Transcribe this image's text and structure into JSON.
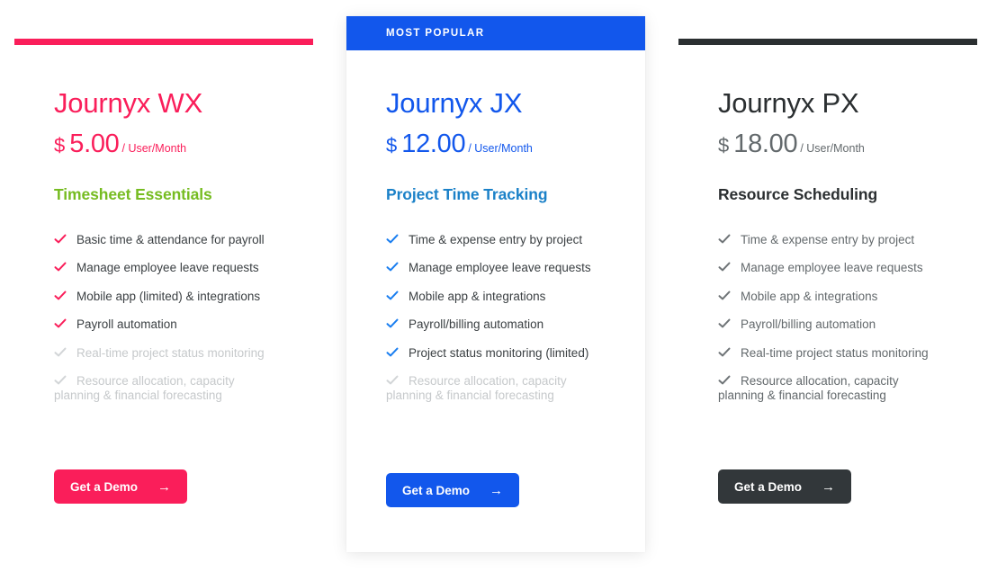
{
  "page": {
    "background": "#ffffff",
    "button_label": "Get a Demo",
    "arrow_glyph": "→",
    "currency_symbol": "$",
    "period_label": "/ User/Month"
  },
  "colors": {
    "pink": "#fa1e5a",
    "blue": "#1257ec",
    "dark": "#32373a",
    "green": "#76bc21",
    "tagline_blue": "#1b81c8",
    "feature_text": "#3a3f42",
    "feature_disabled": "#c6c9cb"
  },
  "plans": [
    {
      "id": "wx",
      "name": "Journyx WX",
      "price": "5.00",
      "currency": "$",
      "period": "/ User/Month",
      "tagline": "Timesheet Essentials",
      "badge": null,
      "accent": "#fa1e5a",
      "tagline_color": "#76bc21",
      "button_label": "Get a Demo",
      "features": [
        {
          "text": "Basic time & attendance for payroll",
          "enabled": true
        },
        {
          "text": "Manage employee leave requests",
          "enabled": true
        },
        {
          "text": "Mobile app (limited) & integrations",
          "enabled": true
        },
        {
          "text": "Payroll automation",
          "enabled": true
        },
        {
          "text": "Real-time project status monitoring",
          "enabled": false
        },
        {
          "text": "Resource allocation, capacity planning & financial forecasting",
          "enabled": false,
          "line1": "Resource allocation, capacity",
          "line2": "planning & financial forecasting"
        }
      ]
    },
    {
      "id": "jx",
      "name": "Journyx JX",
      "price": "12.00",
      "currency": "$",
      "period": "/ User/Month",
      "tagline": "Project Time Tracking",
      "badge": "MOST POPULAR",
      "accent": "#1257ec",
      "tagline_color": "#1b81c8",
      "button_label": "Get a Demo",
      "features": [
        {
          "text": "Time & expense entry by project",
          "enabled": true
        },
        {
          "text": "Manage employee leave requests",
          "enabled": true
        },
        {
          "text": "Mobile app & integrations",
          "enabled": true
        },
        {
          "text": "Payroll/billing automation",
          "enabled": true
        },
        {
          "text": "Project status monitoring (limited)",
          "enabled": true
        },
        {
          "text": "Resource allocation, capacity planning & financial forecasting",
          "enabled": false,
          "line1": "Resource allocation, capacity",
          "line2": "planning & financial forecasting"
        }
      ]
    },
    {
      "id": "px",
      "name": "Journyx PX",
      "price": "18.00",
      "currency": "$",
      "period": "/ User/Month",
      "tagline": "Resource Scheduling",
      "badge": null,
      "accent": "#2b2f31",
      "tagline_color": "#2b2f31",
      "button_label": "Get a Demo",
      "features": [
        {
          "text": "Time & expense entry by project",
          "enabled": true
        },
        {
          "text": "Manage employee leave requests",
          "enabled": true
        },
        {
          "text": "Mobile app & integrations",
          "enabled": true
        },
        {
          "text": "Payroll/billing automation",
          "enabled": true
        },
        {
          "text": "Real-time project status monitoring",
          "enabled": true
        },
        {
          "text": "Resource allocation, capacity planning & financial forecasting",
          "enabled": true,
          "line1": "Resource allocation, capacity",
          "line2": "planning & financial forecasting"
        }
      ]
    }
  ]
}
